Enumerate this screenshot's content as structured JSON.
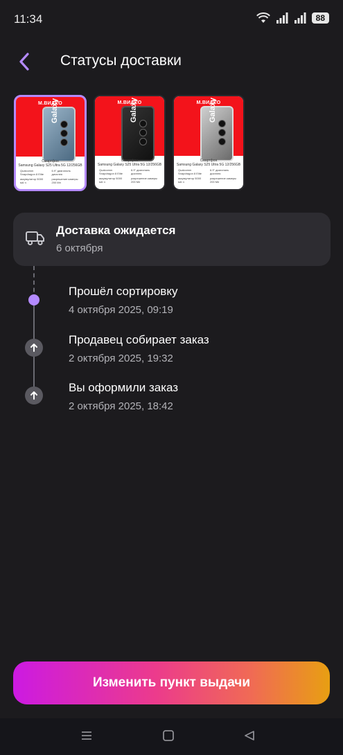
{
  "status_bar": {
    "time": "11:34",
    "battery": "88"
  },
  "header": {
    "title": "Статусы доставки"
  },
  "thumbnails": [
    {
      "brand": "М.ВИДЕО",
      "model": "Galaxy S25 Ultra",
      "caption_line1": "Смартфон",
      "caption_line2": "Samsung Galaxy S25 Ultra 5G 12/256GB",
      "spec1": "Qualcomm Snapdragon 8 Elite",
      "spec2": "6.9\" диагональ дисплея",
      "spec3": "аккумулятор 5000 мА·ч",
      "spec4": "разрешение камеры 200 Мп"
    },
    {
      "brand": "М.ВИДЕО",
      "model": "Galaxy S25 Ultra",
      "caption_line1": "Смартфон",
      "caption_line2": "Samsung Galaxy S25 Ultra 5G 12/256GB",
      "spec1": "Qualcomm Snapdragon 8 Elite",
      "spec2": "6.9\" диагональ дисплея",
      "spec3": "аккумулятор 5000 мА·ч",
      "spec4": "разрешение камеры 200 Мп"
    },
    {
      "brand": "М.ВИДЕО",
      "model": "Galaxy S25 Ultra",
      "caption_line1": "Смартфон",
      "caption_line2": "Samsung Galaxy S25 Ultra 5G 12/256GB",
      "spec1": "Qualcomm Snapdragon 8 Elite",
      "spec2": "6.9\" диагональ дисплея",
      "spec3": "аккумулятор 5000 мА·ч",
      "spec4": "разрешение камеры 200 Мп"
    }
  ],
  "delivery": {
    "title": "Доставка ожидается",
    "date": "6 октября"
  },
  "events": [
    {
      "title": "Прошёл сортировку",
      "time": "4 октября 2025, 09:19"
    },
    {
      "title": "Продавец собирает заказ",
      "time": "2 октября 2025, 19:32"
    },
    {
      "title": "Вы оформили заказ",
      "time": "2 октября 2025, 18:42"
    }
  ],
  "cta": {
    "label": "Изменить пункт выдачи"
  },
  "colors": {
    "accent": "#b48aff",
    "background": "#1c1b1e",
    "card": "#2d2c31"
  }
}
